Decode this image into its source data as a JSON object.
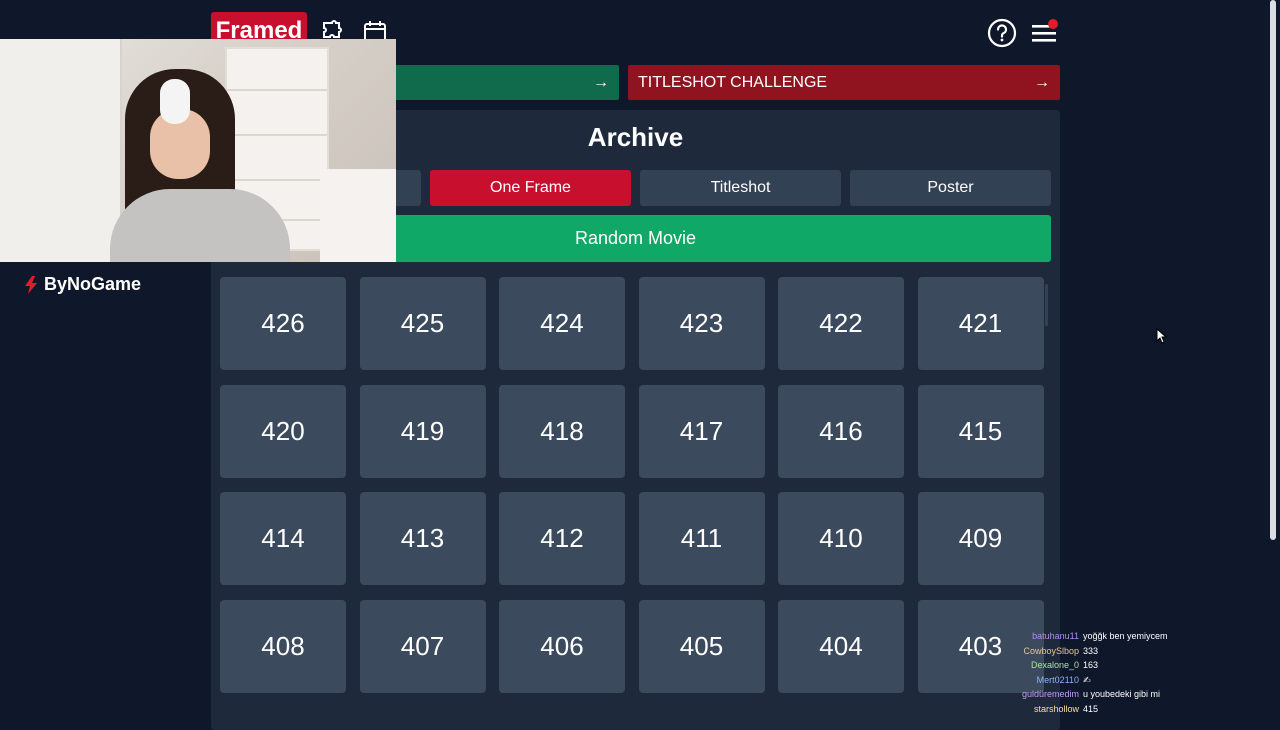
{
  "header": {
    "logo_text": "Framed",
    "icons": [
      "puzzle-icon",
      "calendar-icon",
      "help-icon",
      "menu-icon"
    ]
  },
  "banners": {
    "green_arrow": "→",
    "red_label": "TITLESHOT CHALLENGE",
    "red_arrow": "→"
  },
  "archive": {
    "title": "Archive",
    "modes": [
      {
        "label": "One Frame",
        "active": true
      },
      {
        "label": "Titleshot",
        "active": false
      },
      {
        "label": "Poster",
        "active": false
      }
    ],
    "random_button": "Random Movie",
    "tiles": [
      "426",
      "425",
      "424",
      "423",
      "422",
      "421",
      "420",
      "419",
      "418",
      "417",
      "416",
      "415",
      "414",
      "413",
      "412",
      "411",
      "410",
      "409",
      "408",
      "407",
      "406",
      "405",
      "404",
      "403"
    ]
  },
  "overlay": {
    "brand": "ByNoGame"
  },
  "chat": [
    {
      "user": "batuhanu11",
      "msg": "yoğğk ben yemiycem",
      "color": "#b48cf0"
    },
    {
      "user": "CowboySlbop",
      "msg": "333",
      "color": "#e6c79a"
    },
    {
      "user": "Dexalone_0",
      "msg": "163",
      "color": "#a6e3a1"
    },
    {
      "user": "Mert02110",
      "msg": "✍",
      "color": "#89b4fa"
    },
    {
      "user": "guldüremedim",
      "msg": "u youbedeki gibi mi",
      "color": "#c39bf5"
    },
    {
      "user": "starshollow",
      "msg": "415",
      "color": "#f5e0a0"
    }
  ],
  "colors": {
    "background": "#0f172a",
    "panel": "#1e293b",
    "tile": "#3c4a5e",
    "brand_red": "#c8102e",
    "green": "#10a866"
  }
}
